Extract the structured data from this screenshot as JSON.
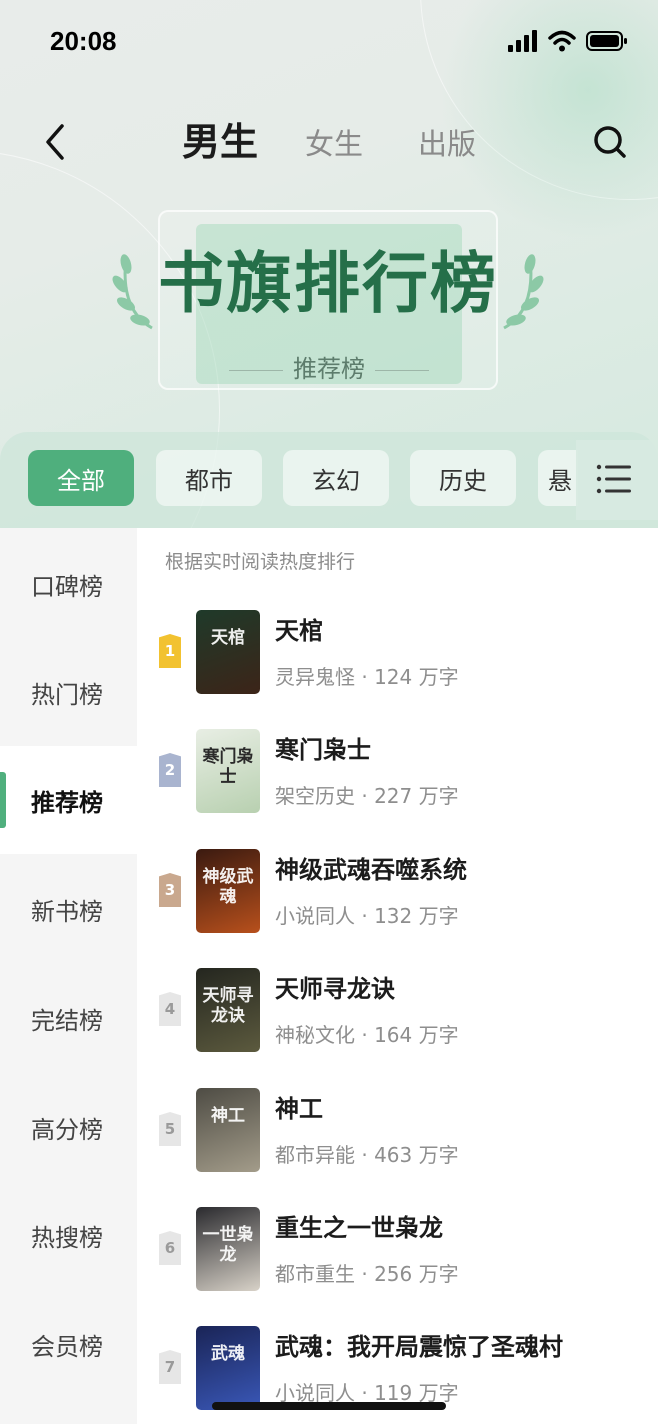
{
  "status_bar": {
    "time": "20:08"
  },
  "nav": {
    "tabs": [
      {
        "label": "男生",
        "active": true
      },
      {
        "label": "女生",
        "active": false
      },
      {
        "label": "出版",
        "active": false
      }
    ]
  },
  "banner": {
    "title": "书旗排行榜",
    "subtitle": "推荐榜"
  },
  "categories": [
    {
      "label": "全部",
      "active": true
    },
    {
      "label": "都市",
      "active": false
    },
    {
      "label": "玄幻",
      "active": false
    },
    {
      "label": "历史",
      "active": false
    },
    {
      "label": "悬",
      "active": false
    }
  ],
  "sidebar": {
    "items": [
      {
        "label": "口碑榜",
        "active": false
      },
      {
        "label": "热门榜",
        "active": false
      },
      {
        "label": "推荐榜",
        "active": true
      },
      {
        "label": "新书榜",
        "active": false
      },
      {
        "label": "完结榜",
        "active": false
      },
      {
        "label": "高分榜",
        "active": false
      },
      {
        "label": "热搜榜",
        "active": false
      },
      {
        "label": "会员榜",
        "active": false
      }
    ]
  },
  "list": {
    "hint": "根据实时阅读热度排行",
    "books": [
      {
        "rank": "1",
        "title": "天棺",
        "meta": "灵异鬼怪 · 124 万字",
        "cover_text": "天棺",
        "badge_color": "#f2c230",
        "cover_colors": [
          "#1f3a2a",
          "#3c2418"
        ]
      },
      {
        "rank": "2",
        "title": "寒门枭士",
        "meta": "架空历史 · 227 万字",
        "cover_text": "寒门枭士",
        "badge_color": "#a9b4cf",
        "cover_colors": [
          "#e8eee4",
          "#b8d0b0"
        ]
      },
      {
        "rank": "3",
        "title": "神级武魂吞噬系统",
        "meta": "小说同人 · 132 万字",
        "cover_text": "神级武魂",
        "badge_color": "#c9a88e",
        "cover_colors": [
          "#3a1a10",
          "#b8501c"
        ]
      },
      {
        "rank": "4",
        "title": "天师寻龙诀",
        "meta": "神秘文化 · 164 万字",
        "cover_text": "天师寻龙诀",
        "badge_color": "#e6e6e6",
        "cover_colors": [
          "#24261f",
          "#5c5a3e"
        ]
      },
      {
        "rank": "5",
        "title": "神工",
        "meta": "都市异能 · 463 万字",
        "cover_text": "神工",
        "badge_color": "#e6e6e6",
        "cover_colors": [
          "#4e4c44",
          "#a39c8a"
        ]
      },
      {
        "rank": "6",
        "title": "重生之一世枭龙",
        "meta": "都市重生 · 256 万字",
        "cover_text": "一世枭龙",
        "badge_color": "#e6e6e6",
        "cover_colors": [
          "#2a2a2e",
          "#d8d2c8"
        ]
      },
      {
        "rank": "7",
        "title": "武魂：我开局震惊了圣魂村",
        "meta": "小说同人 · 119 万字",
        "cover_text": "武魂",
        "badge_color": "#e6e6e6",
        "cover_colors": [
          "#1a2456",
          "#3a58b8"
        ]
      }
    ]
  },
  "colors": {
    "accent": "#4faf7d",
    "banner_title": "#256f49"
  }
}
